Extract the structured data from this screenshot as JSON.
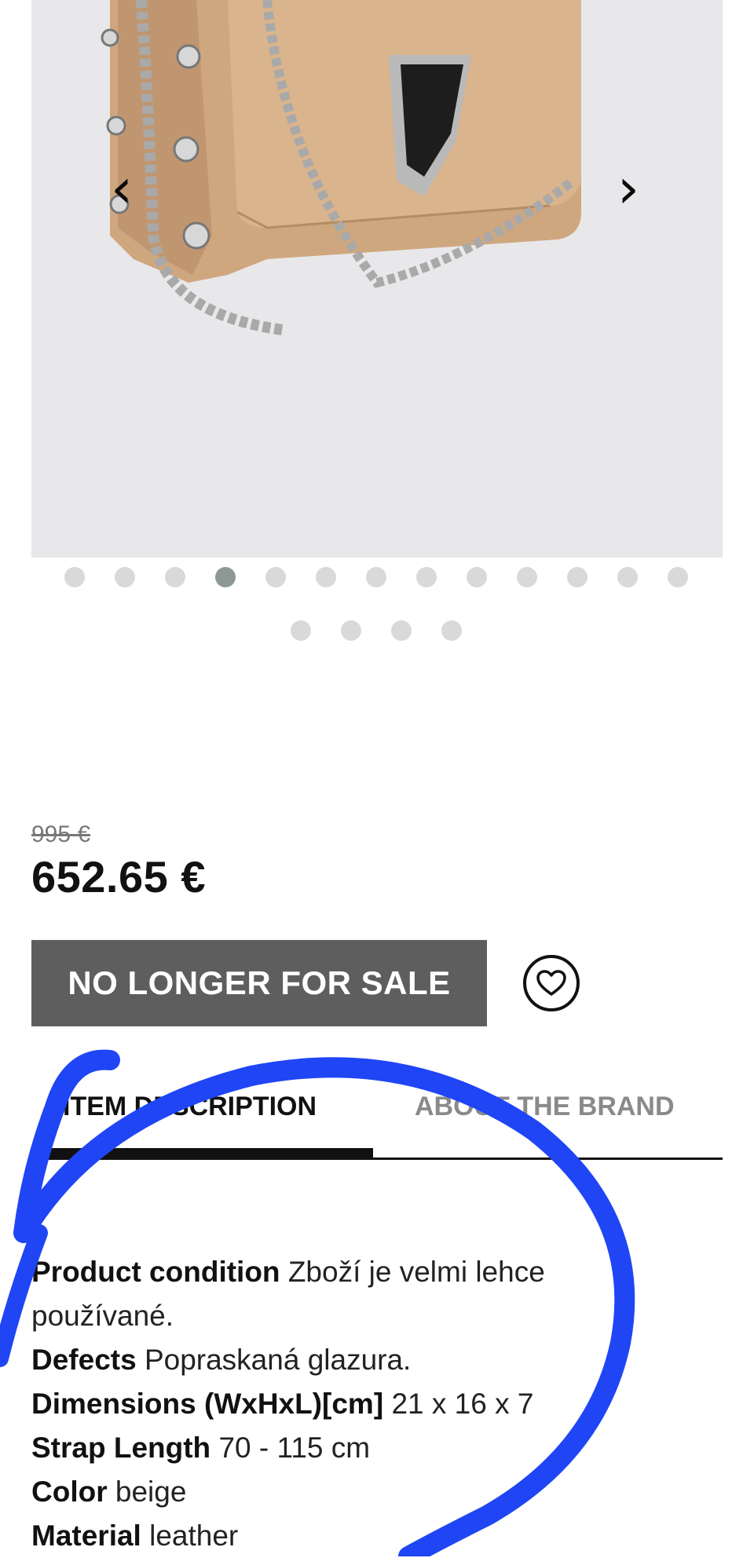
{
  "gallery": {
    "prev_label": "‹",
    "next_label": "›",
    "dots_total": 17,
    "active_dot": 4
  },
  "price": {
    "original": "995 €",
    "current": "652.65 €"
  },
  "actions": {
    "sold_label": "NO LONGER FOR SALE"
  },
  "tabs": [
    {
      "label": "ITEM DESCRIPTION"
    },
    {
      "label": "ABOUT THE BRAND"
    }
  ],
  "details": [
    {
      "label": "Product condition",
      "value": "Zboží je velmi lehce používané."
    },
    {
      "label": "Defects",
      "value": "Popraskaná glazura."
    },
    {
      "label": "Dimensions (WxHxL)[cm]",
      "value": "21 x 16 x 7"
    },
    {
      "label": "Strap Length",
      "value": "70 - 115 cm"
    },
    {
      "label": "Color",
      "value": "beige"
    },
    {
      "label": "Material",
      "value": "leather"
    }
  ],
  "colors": {
    "button_bg": "#5e5e5e",
    "active_dot": "#8d9a93",
    "annotation": "#1f45f5"
  },
  "icons": [
    "chevron-left-icon",
    "chevron-right-icon",
    "heart-icon"
  ]
}
